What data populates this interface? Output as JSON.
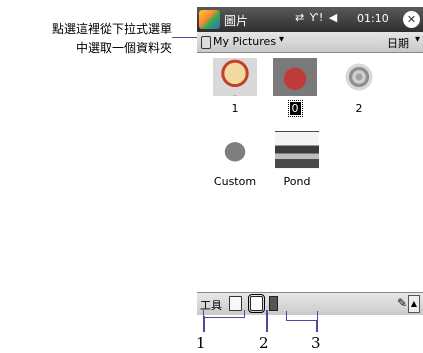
{
  "callout": {
    "line1": "點選這裡從下拉式選單",
    "line2": "中選取一個資料夾"
  },
  "titlebar": {
    "title": "圖片",
    "status": "⇄ Ƴ! ◀",
    "time": "01:10",
    "close": "✕"
  },
  "toolbar": {
    "folder": "My Pictures",
    "folder_arrow": "▾",
    "sort": "日期",
    "sort_arrow": "▾"
  },
  "thumbnails": [
    {
      "caption": "1",
      "image": "clown-image"
    },
    {
      "caption": "0",
      "image": "heart-image",
      "selected": true
    },
    {
      "caption": "2",
      "image": "rings-image"
    },
    {
      "caption": "Custom",
      "image": "dog-image"
    },
    {
      "caption": "Pond",
      "image": "pond-image"
    }
  ],
  "menubar": {
    "tools": "工具",
    "input_icon": "✎",
    "up_arrow": "▲"
  },
  "numbers": {
    "n1": "1",
    "n2": "2",
    "n3": "3"
  }
}
